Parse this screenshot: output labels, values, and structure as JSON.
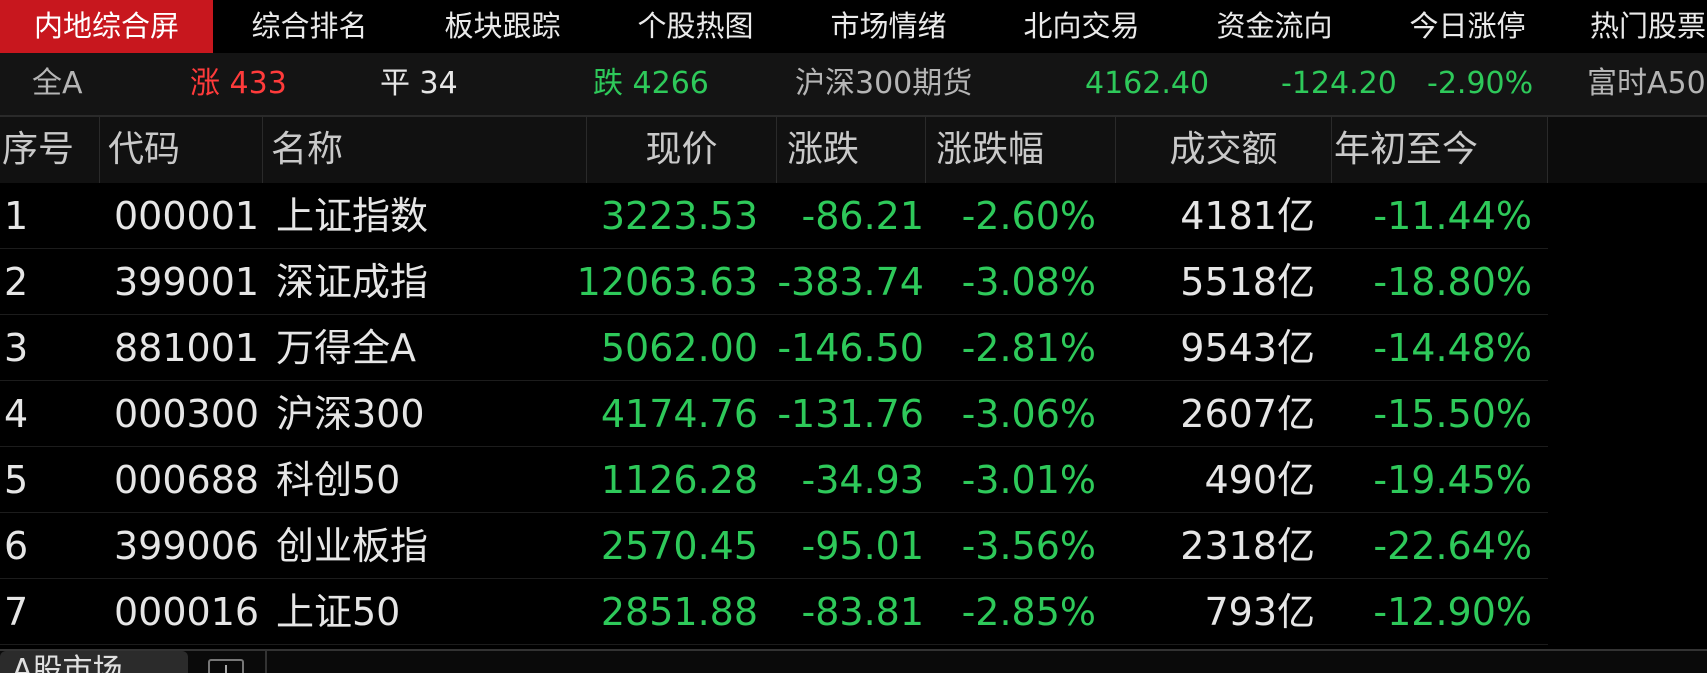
{
  "tabs": [
    {
      "label": "内地综合屏",
      "active": true
    },
    {
      "label": "综合排名",
      "active": false
    },
    {
      "label": "板块跟踪",
      "active": false
    },
    {
      "label": "个股热图",
      "active": false
    },
    {
      "label": "市场情绪",
      "active": false
    },
    {
      "label": "北向交易",
      "active": false
    },
    {
      "label": "资金流向",
      "active": false
    },
    {
      "label": "今日涨停",
      "active": false
    },
    {
      "label": "热门股票",
      "active": false
    }
  ],
  "summary": {
    "market": "全A",
    "up": "涨 433",
    "flat": "平 34",
    "down": "跌 4266",
    "futures_name": "沪深300期货",
    "futures_price": "4162.40",
    "futures_change": "-124.20",
    "futures_pct": "-2.90%",
    "next_item": "富时A50"
  },
  "table": {
    "columns": [
      "序号",
      "代码",
      "名称",
      "现价",
      "涨跌",
      "涨跌幅",
      "成交额",
      "年初至今"
    ],
    "rows": [
      {
        "idx": "1",
        "code": "000001",
        "name": "上证指数",
        "price": "3223.53",
        "change": "-86.21",
        "pct": "-2.60%",
        "amount": "4181亿",
        "ytd": "-11.44%"
      },
      {
        "idx": "2",
        "code": "399001",
        "name": "深证成指",
        "price": "12063.63",
        "change": "-383.74",
        "pct": "-3.08%",
        "amount": "5518亿",
        "ytd": "-18.80%"
      },
      {
        "idx": "3",
        "code": "881001",
        "name": "万得全A",
        "price": "5062.00",
        "change": "-146.50",
        "pct": "-2.81%",
        "amount": "9543亿",
        "ytd": "-14.48%"
      },
      {
        "idx": "4",
        "code": "000300",
        "name": "沪深300",
        "price": "4174.76",
        "change": "-131.76",
        "pct": "-3.06%",
        "amount": "2607亿",
        "ytd": "-15.50%"
      },
      {
        "idx": "5",
        "code": "000688",
        "name": "科创50",
        "price": "1126.28",
        "change": "-34.93",
        "pct": "-3.01%",
        "amount": "490亿",
        "ytd": "-19.45%"
      },
      {
        "idx": "6",
        "code": "399006",
        "name": "创业板指",
        "price": "2570.45",
        "change": "-95.01",
        "pct": "-3.56%",
        "amount": "2318亿",
        "ytd": "-22.64%"
      },
      {
        "idx": "7",
        "code": "000016",
        "name": "上证50",
        "price": "2851.88",
        "change": "-83.81",
        "pct": "-2.85%",
        "amount": "793亿",
        "ytd": "-12.90%"
      }
    ]
  },
  "sheet": {
    "tab_label": "A股市场",
    "add_icon": "plus-icon"
  },
  "colors": {
    "active_tab": "#c8171e",
    "up": "#ff3b3b",
    "down": "#2ec95a",
    "background": "#000000"
  }
}
